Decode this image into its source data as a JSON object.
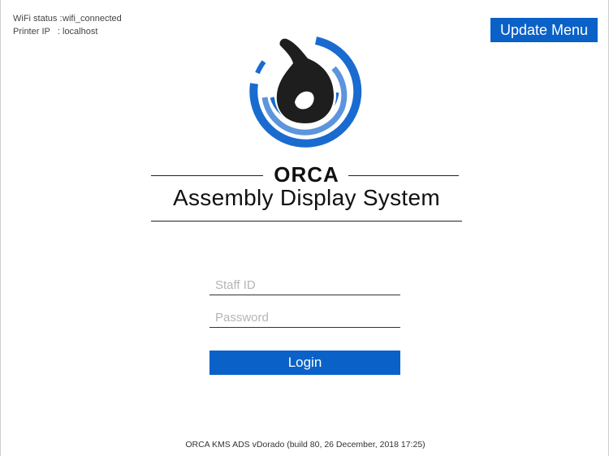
{
  "status": {
    "wifi_label": "WiFi status :",
    "wifi_value": "wifi_connected",
    "printer_label": "Printer IP   :",
    "printer_value": "localhost"
  },
  "header": {
    "update_menu_label": "Update Menu"
  },
  "brand": {
    "name": "ORCA",
    "subtitle": "Assembly Display System"
  },
  "login_form": {
    "staff_id_placeholder": "Staff ID",
    "password_placeholder": "Password",
    "login_label": "Login"
  },
  "footer": {
    "build_info": "ORCA KMS ADS vDorado (build 80, 26 December, 2018 17:25)"
  },
  "colors": {
    "accent": "#0a61c8",
    "logo_blue": "#1a6bd0",
    "logo_light_blue": "#5c95dd",
    "logo_black": "#1e1e1e"
  },
  "icons": {
    "logo": "orca-logo-icon"
  }
}
